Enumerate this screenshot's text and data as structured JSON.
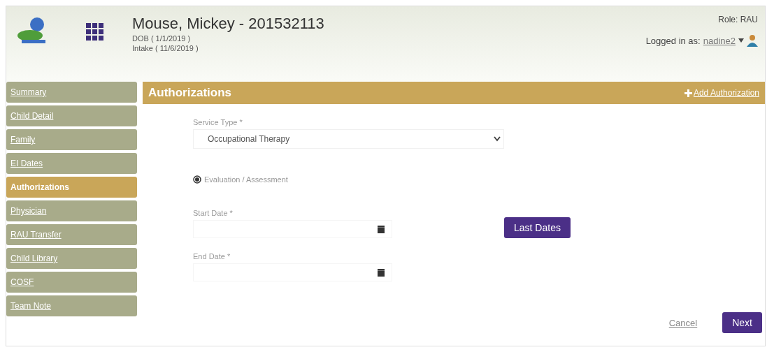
{
  "header": {
    "patient": "Mouse, Mickey - 201532113",
    "dob": "DOB ( 1/1/2019 )",
    "intake": "Intake ( 11/6/2019 )",
    "role": "Role: RAU",
    "logged_in_label": "Logged in as:",
    "username": "nadine2"
  },
  "sidebar": {
    "items": [
      {
        "label": "Summary",
        "selected": false
      },
      {
        "label": "Child Detail",
        "selected": false
      },
      {
        "label": "Family",
        "selected": false
      },
      {
        "label": "EI Dates",
        "selected": false
      },
      {
        "label": "Authorizations",
        "selected": true
      },
      {
        "label": "Physician",
        "selected": false
      },
      {
        "label": "RAU Transfer",
        "selected": false
      },
      {
        "label": "Child Library",
        "selected": false
      },
      {
        "label": "COSF",
        "selected": false
      },
      {
        "label": "Team Note",
        "selected": false
      }
    ]
  },
  "panel": {
    "title": "Authorizations",
    "add_link": "Add Authorization"
  },
  "form": {
    "service_type": {
      "label": "Service Type *",
      "value": "Occupational Therapy"
    },
    "radio": {
      "label": "Evaluation / Assessment",
      "selected": true
    },
    "start_date": {
      "label": "Start Date *"
    },
    "end_date": {
      "label": "End Date *"
    },
    "last_dates_button": "Last Dates"
  },
  "footer": {
    "cancel": "Cancel",
    "next": "Next"
  }
}
